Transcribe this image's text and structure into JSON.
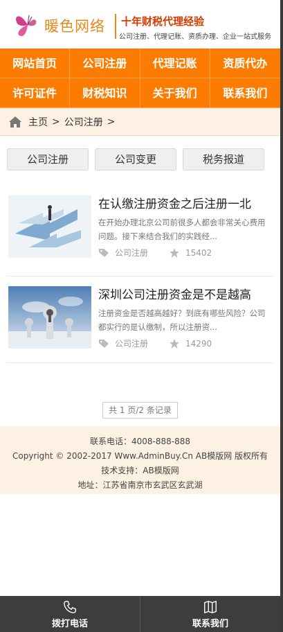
{
  "header": {
    "logo_text": "暖色网络",
    "slogan": "十年财税代理经验",
    "services": "公司注册、代理记账、资质办理、企业一站式服务"
  },
  "nav": [
    "网站首页",
    "公司注册",
    "代理记账",
    "资质代办",
    "许可证件",
    "财税知识",
    "关于我们",
    "联系我们"
  ],
  "breadcrumb": {
    "home": "主页",
    "sep1": ">",
    "current": "公司注册",
    "sep2": ">"
  },
  "tabs": [
    "公司注册",
    "公司变更",
    "税务报道"
  ],
  "articles": [
    {
      "title": "在认缴注册资金之后注册一北",
      "desc": "在开始办理北京公司前很多人都会非常关心费用问题。接下来结合我们的实践经...",
      "category": "公司注册",
      "views": "15402",
      "thumb_icon": "arrows-businessman-image"
    },
    {
      "title": "深圳公司注册资金是不是越高",
      "desc": "注册资金是否越高越好？到底有哪些风险？公司都实行的是认缴制，所以注册资...",
      "category": "公司注册",
      "views": "14290",
      "thumb_icon": "keyhole-sky-image"
    }
  ],
  "pager": "共 1 页/2 条记录",
  "footer": {
    "phone": "联系电话：4008-888-888",
    "copyright": "Copyright © 2002-2017 Www.AdminBuy.Cn AB模版网 版权所有",
    "support": "技术支持：AB模版网",
    "address": "地址：江苏省南京市玄武区玄武湖"
  },
  "bottombar": {
    "call": "拨打电话",
    "contact": "联系我们"
  },
  "colors": {
    "nav_orange": "#fb7c00",
    "logo_orange": "#e2891a",
    "slogan_red": "#d73a00",
    "crumb_bg": "#fdf1e3",
    "bottombar_bg": "#3d3d3d"
  }
}
